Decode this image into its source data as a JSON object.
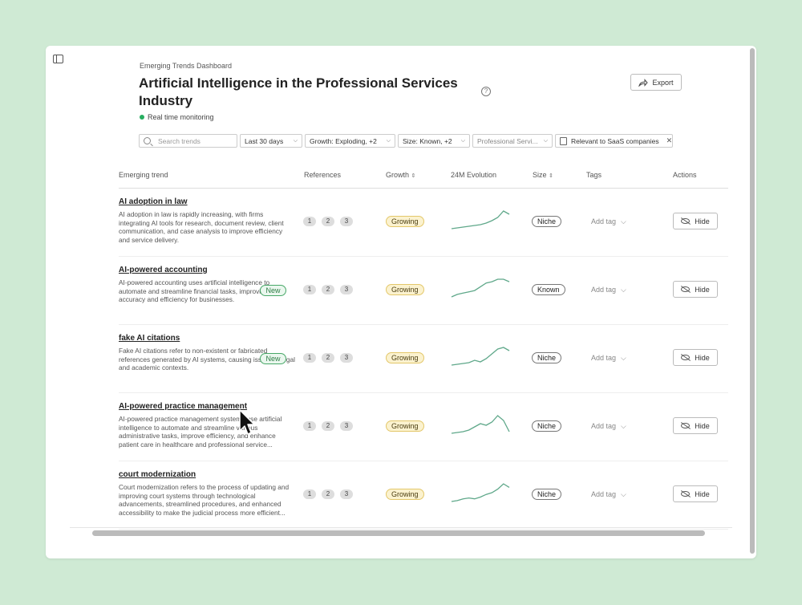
{
  "app": {
    "breadcrumb": "Emerging Trends Dashboard",
    "title": "Artificial Intelligence in the Professional Services Industry",
    "status": "Real time monitoring",
    "export_label": "Export",
    "help_glyph": "?"
  },
  "filters": {
    "search_placeholder": "Search trends",
    "date": "Last 30 days",
    "growth": "Growth: Exploding, +2",
    "size": "Size: Known, +2",
    "industry": "Professional Servi...",
    "relevance": "Relevant to SaaS companies"
  },
  "columns": {
    "trend": "Emerging trend",
    "references": "References",
    "growth": "Growth",
    "evolution": "24M Evolution",
    "size": "Size",
    "tags": "Tags",
    "actions": "Actions"
  },
  "icons": {
    "sort": "⇕",
    "chevron": "⌵",
    "close": "✕"
  },
  "colors": {
    "background": "#cfead4",
    "sparkline": "#5fa88a",
    "growing_bg": "#fbf2cf",
    "new_badge": "#48a868"
  },
  "rows": [
    {
      "title": "AI adoption in law",
      "description": "AI adoption in law is rapidly increasing, with firms integrating AI tools for research, document review, client communication, and case analysis to improve efficiency and service delivery.",
      "badge": "",
      "references": [
        "1",
        "2",
        "3"
      ],
      "growth": "Growing",
      "size": "Niche",
      "add_tag": "Add tag",
      "hide_label": "Hide",
      "evolution": [
        2,
        2.5,
        3,
        3.5,
        4,
        4.5,
        5.5,
        7,
        9,
        13,
        11
      ]
    },
    {
      "title": "AI-powered accounting",
      "description": "AI-powered accounting uses artificial intelligence to automate and streamline financial tasks, improving accuracy and efficiency for businesses.",
      "badge": "New",
      "references": [
        "1",
        "2",
        "3"
      ],
      "growth": "Growing",
      "size": "Known",
      "add_tag": "Add tag",
      "hide_label": "Hide",
      "evolution": [
        2,
        3,
        3.5,
        4,
        4.5,
        6,
        7.5,
        8,
        9,
        9,
        8
      ]
    },
    {
      "title": "fake AI citations",
      "description": "Fake AI citations refer to non-existent or fabricated references generated by AI systems, causing issues in legal and academic contexts.",
      "badge": "New",
      "references": [
        "1",
        "2",
        "3"
      ],
      "growth": "Growing",
      "size": "Niche",
      "add_tag": "Add tag",
      "hide_label": "Hide",
      "evolution": [
        2,
        2.5,
        3,
        3.5,
        5,
        4,
        6,
        9,
        12,
        13,
        11
      ]
    },
    {
      "title": "AI-powered practice management",
      "description": "AI-powered practice management systems use artificial intelligence to automate and streamline various administrative tasks, improve efficiency, and enhance patient care in healthcare and professional service...",
      "badge": "",
      "references": [
        "1",
        "2",
        "3"
      ],
      "growth": "Growing",
      "size": "Niche",
      "add_tag": "Add tag",
      "hide_label": "Hide",
      "evolution": [
        2,
        2.5,
        3,
        4,
        6,
        8,
        7,
        9,
        13,
        10,
        3
      ]
    },
    {
      "title": "court modernization",
      "description": "Court modernization refers to the process of updating and improving court systems through technological advancements, streamlined procedures, and enhanced accessibility to make the judicial process more efficient...",
      "badge": "",
      "references": [
        "1",
        "2",
        "3"
      ],
      "growth": "Growing",
      "size": "Niche",
      "add_tag": "Add tag",
      "hide_label": "Hide",
      "evolution": [
        2,
        2.5,
        3.5,
        4,
        3.5,
        4.5,
        6,
        7,
        9,
        12,
        10
      ]
    }
  ]
}
